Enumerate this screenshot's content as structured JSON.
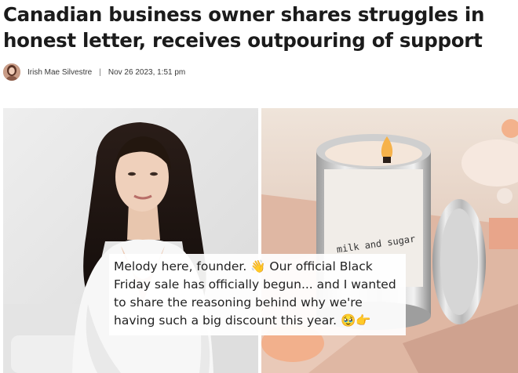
{
  "article": {
    "headline": "Canadian business owner shares struggles in honest letter, receives outpouring of support",
    "author": "Irish Mae Silvestre",
    "separator": "|",
    "date": "Nov 26 2023, 1:51 pm"
  },
  "image": {
    "candle_label": "milk and sugar",
    "caption_text": "Melody here, founder. 👋 Our official Black Friday sale has officially begun... and I wanted to share the reasoning behind why we're having such a big discount this year. 🥹👉"
  }
}
